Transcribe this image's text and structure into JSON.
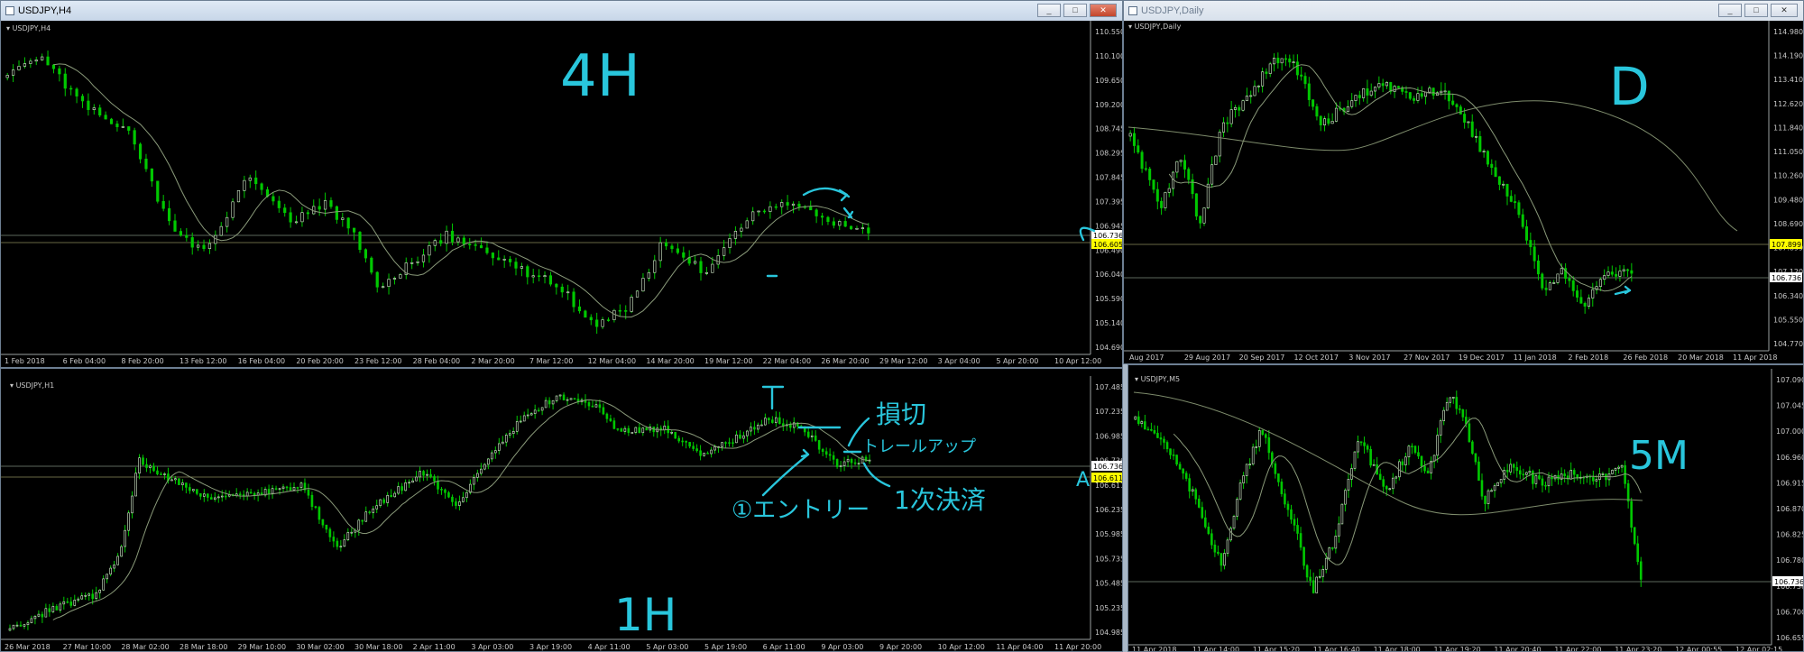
{
  "windows": {
    "h4": {
      "title": "USDJPY,H4",
      "label": "USDJPY,H4",
      "annotation": "4H",
      "price_ticks": [
        "110.550",
        "110.100",
        "109.650",
        "109.200",
        "108.745",
        "108.295",
        "107.845",
        "107.395",
        "106.945",
        "106.490",
        "106.040",
        "105.590",
        "105.140",
        "104.690"
      ],
      "time_ticks": [
        "1 Feb 2018",
        "6 Feb 04:00",
        "8 Feb 20:00",
        "13 Feb 12:00",
        "16 Feb 04:00",
        "20 Feb 20:00",
        "23 Feb 12:00",
        "28 Feb 04:00",
        "2 Mar 20:00",
        "7 Mar 12:00",
        "12 Mar 04:00",
        "14 Mar 20:00",
        "19 Mar 12:00",
        "22 Mar 04:00",
        "26 Mar 20:00",
        "29 Mar 12:00",
        "3 Apr 04:00",
        "5 Apr 20:00",
        "10 Apr 12:00"
      ],
      "bid_price": "106.736",
      "line_price": "106.605",
      "price_range": [
        104.69,
        110.55
      ]
    },
    "daily": {
      "title": "USDJPY,Daily",
      "label": "USDJPY,Daily",
      "annotation": "D",
      "price_ticks": [
        "114.980",
        "114.190",
        "113.410",
        "112.620",
        "111.840",
        "111.050",
        "110.260",
        "109.480",
        "108.690",
        "107.899",
        "107.120",
        "106.340",
        "105.550",
        "104.770"
      ],
      "time_ticks": [
        "Aug 2017",
        "29 Aug 2017",
        "20 Sep 2017",
        "12 Oct 2017",
        "3 Nov 2017",
        "27 Nov 2017",
        "19 Dec 2017",
        "11 Jan 2018",
        "2 Feb 2018",
        "26 Feb 2018",
        "20 Mar 2018",
        "11 Apr 2018"
      ],
      "bid_price": "106.736",
      "line_price": "107.899",
      "price_range": [
        104.77,
        114.98
      ]
    },
    "h1": {
      "label": "USDJPY,H1",
      "annotation": "1H",
      "notes": {
        "stop": "損切",
        "trail": "トレールアップ",
        "entry": "①エントリー",
        "take": "1次決済"
      },
      "price_ticks": [
        "107.485",
        "107.235",
        "106.985",
        "106.736",
        "106.611",
        "106.235",
        "105.985",
        "105.735",
        "105.485",
        "105.235",
        "104.985"
      ],
      "time_ticks": [
        "26 Mar 2018",
        "27 Mar 10:00",
        "28 Mar 02:00",
        "28 Mar 18:00",
        "29 Mar 10:00",
        "30 Mar 02:00",
        "30 Mar 18:00",
        "2 Apr 11:00",
        "3 Apr 03:00",
        "3 Apr 19:00",
        "4 Apr 11:00",
        "5 Apr 03:00",
        "5 Apr 19:00",
        "6 Apr 11:00",
        "9 Apr 03:00",
        "9 Apr 20:00",
        "10 Apr 12:00",
        "11 Apr 04:00",
        "11 Apr 20:00"
      ],
      "bid_price": "106.736",
      "line_price": "106.611",
      "price_range": [
        104.985,
        107.485
      ]
    },
    "m5": {
      "label": "USDJPY,M5",
      "annotation": "5M",
      "price_ticks": [
        "107.090",
        "107.045",
        "107.000",
        "106.960",
        "106.915",
        "106.870",
        "106.825",
        "106.780",
        "106.736",
        "106.700",
        "106.655"
      ],
      "time_ticks": [
        "11 Apr 2018",
        "11 Apr 14:00",
        "11 Apr 15:20",
        "11 Apr 16:40",
        "11 Apr 18:00",
        "11 Apr 19:20",
        "11 Apr 20:40",
        "11 Apr 22:00",
        "11 Apr 23:20",
        "12 Apr 00:55",
        "12 Apr 02:15"
      ],
      "bid_price": "106.736",
      "price_range": [
        106.64,
        107.095
      ]
    }
  },
  "colors": {
    "background": "#000000",
    "candle_up": "#00c800",
    "candle_outline": "#d8f0d0",
    "ma_line": "#8a9a7a",
    "bid_line": "#7a8a7a",
    "highlight_label": "#ffff00",
    "annotation": "#29c6dc"
  }
}
